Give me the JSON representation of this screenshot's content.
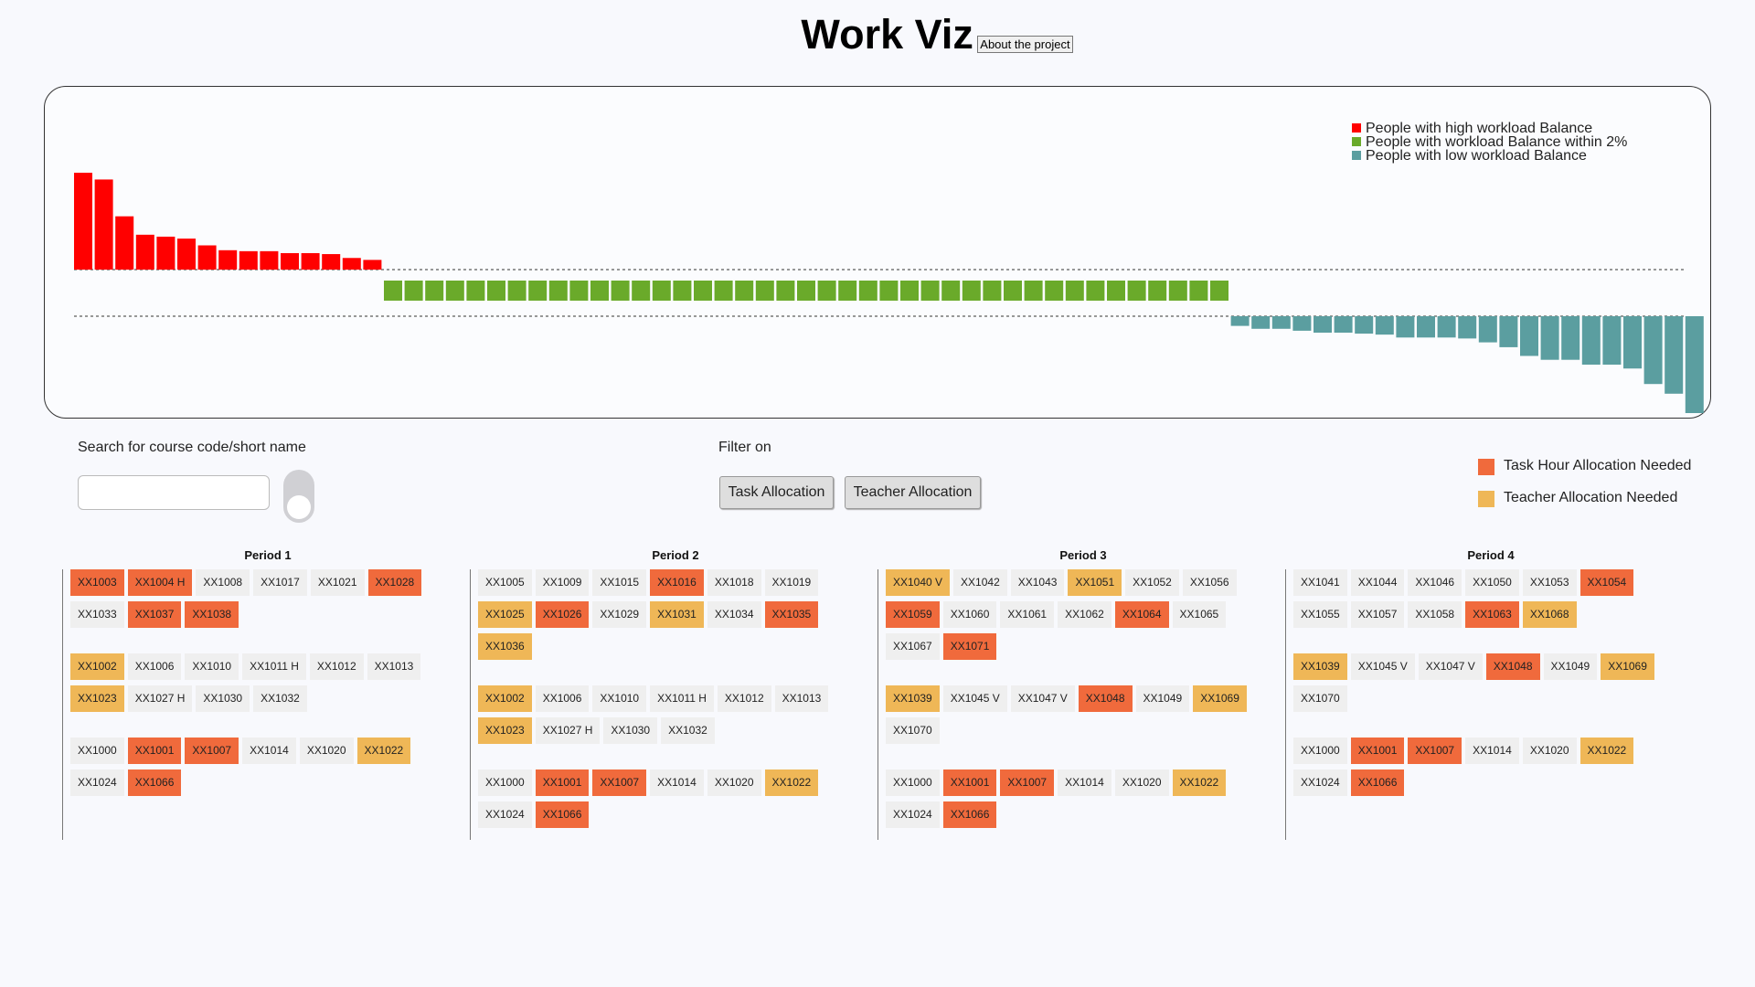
{
  "header": {
    "title": "Work Viz",
    "about_label": "About the project"
  },
  "legend": [
    {
      "label": "People with high workload Balance",
      "color": "#ff0000"
    },
    {
      "label": "People with workload Balance within 2%",
      "color": "#6aaa2a"
    },
    {
      "label": "People with low workload Balance",
      "color": "#5b9ea0"
    }
  ],
  "chart_data": {
    "type": "bar",
    "high_series": [
      100,
      93,
      55,
      36,
      34,
      32,
      25,
      20,
      19,
      19,
      17,
      17,
      16,
      12,
      10
    ],
    "balanced_count": 41,
    "low_series": [
      -10,
      -13,
      -13,
      -15,
      -17,
      -17,
      -18,
      -19,
      -22,
      -22,
      -22,
      -23,
      -27,
      -32,
      -41,
      -45,
      -45,
      -50,
      -50,
      -54,
      -70,
      -80,
      -100
    ]
  },
  "controls": {
    "search_label": "Search for course code/short name",
    "search_value": "",
    "filter_label": "Filter on",
    "task_btn": "Task Allocation",
    "teacher_btn": "Teacher Allocation",
    "legend_task": "Task Hour Allocation Needed",
    "legend_teacher": "Teacher Allocation Needed",
    "color_task": "#f06a3c",
    "color_teacher": "#efb757"
  },
  "periods": [
    {
      "title": "Period 1",
      "groups": [
        [
          [
            "XX1003",
            "task"
          ],
          [
            "XX1004 H",
            "task"
          ],
          [
            "XX1008",
            ""
          ],
          [
            "XX1017",
            ""
          ],
          [
            "XX1021",
            ""
          ],
          [
            "XX1028",
            "task"
          ],
          [
            "XX1033",
            ""
          ],
          [
            "XX1037",
            "task"
          ],
          [
            "XX1038",
            "task"
          ]
        ],
        [
          [
            "XX1002",
            "teacher"
          ],
          [
            "XX1006",
            ""
          ],
          [
            "XX1010",
            ""
          ],
          [
            "XX1011 H",
            ""
          ],
          [
            "XX1012",
            ""
          ],
          [
            "XX1013",
            ""
          ],
          [
            "XX1023",
            "teacher"
          ],
          [
            "XX1027 H",
            ""
          ],
          [
            "XX1030",
            ""
          ],
          [
            "XX1032",
            ""
          ]
        ],
        [
          [
            "XX1000",
            ""
          ],
          [
            "XX1001",
            "task"
          ],
          [
            "XX1007",
            "task"
          ],
          [
            "XX1014",
            ""
          ],
          [
            "XX1020",
            ""
          ],
          [
            "XX1022",
            "teacher"
          ],
          [
            "XX1024",
            ""
          ],
          [
            "XX1066",
            "task"
          ]
        ]
      ]
    },
    {
      "title": "Period 2",
      "groups": [
        [
          [
            "XX1005",
            ""
          ],
          [
            "XX1009",
            ""
          ],
          [
            "XX1015",
            ""
          ],
          [
            "XX1016",
            "task"
          ],
          [
            "XX1018",
            ""
          ],
          [
            "XX1019",
            ""
          ],
          [
            "XX1025",
            "teacher"
          ],
          [
            "XX1026",
            "task"
          ],
          [
            "XX1029",
            ""
          ],
          [
            "XX1031",
            "teacher"
          ],
          [
            "XX1034",
            ""
          ],
          [
            "XX1035",
            "task"
          ],
          [
            "XX1036",
            "teacher"
          ]
        ],
        [
          [
            "XX1002",
            "teacher"
          ],
          [
            "XX1006",
            ""
          ],
          [
            "XX1010",
            ""
          ],
          [
            "XX1011 H",
            ""
          ],
          [
            "XX1012",
            ""
          ],
          [
            "XX1013",
            ""
          ],
          [
            "XX1023",
            "teacher"
          ],
          [
            "XX1027 H",
            ""
          ],
          [
            "XX1030",
            ""
          ],
          [
            "XX1032",
            ""
          ]
        ],
        [
          [
            "XX1000",
            ""
          ],
          [
            "XX1001",
            "task"
          ],
          [
            "XX1007",
            "task"
          ],
          [
            "XX1014",
            ""
          ],
          [
            "XX1020",
            ""
          ],
          [
            "XX1022",
            "teacher"
          ],
          [
            "XX1024",
            ""
          ],
          [
            "XX1066",
            "task"
          ]
        ]
      ]
    },
    {
      "title": "Period 3",
      "groups": [
        [
          [
            "XX1040 V",
            "teacher"
          ],
          [
            "XX1042",
            ""
          ],
          [
            "XX1043",
            ""
          ],
          [
            "XX1051",
            "teacher"
          ],
          [
            "XX1052",
            ""
          ],
          [
            "XX1056",
            ""
          ],
          [
            "XX1059",
            "task"
          ],
          [
            "XX1060",
            ""
          ],
          [
            "XX1061",
            ""
          ],
          [
            "XX1062",
            ""
          ],
          [
            "XX1064",
            "task"
          ],
          [
            "XX1065",
            ""
          ],
          [
            "XX1067",
            ""
          ],
          [
            "XX1071",
            "task"
          ]
        ],
        [
          [
            "XX1039",
            "teacher"
          ],
          [
            "XX1045 V",
            ""
          ],
          [
            "XX1047 V",
            ""
          ],
          [
            "XX1048",
            "task"
          ],
          [
            "XX1049",
            ""
          ],
          [
            "XX1069",
            "teacher"
          ],
          [
            "XX1070",
            ""
          ]
        ],
        [
          [
            "XX1000",
            ""
          ],
          [
            "XX1001",
            "task"
          ],
          [
            "XX1007",
            "task"
          ],
          [
            "XX1014",
            ""
          ],
          [
            "XX1020",
            ""
          ],
          [
            "XX1022",
            "teacher"
          ],
          [
            "XX1024",
            ""
          ],
          [
            "XX1066",
            "task"
          ]
        ]
      ]
    },
    {
      "title": "Period 4",
      "groups": [
        [
          [
            "XX1041",
            ""
          ],
          [
            "XX1044",
            ""
          ],
          [
            "XX1046",
            ""
          ],
          [
            "XX1050",
            ""
          ],
          [
            "XX1053",
            ""
          ],
          [
            "XX1054",
            "task"
          ],
          [
            "XX1055",
            ""
          ],
          [
            "XX1057",
            ""
          ],
          [
            "XX1058",
            ""
          ],
          [
            "XX1063",
            "task"
          ],
          [
            "XX1068",
            "teacher"
          ]
        ],
        [
          [
            "XX1039",
            "teacher"
          ],
          [
            "XX1045 V",
            ""
          ],
          [
            "XX1047 V",
            ""
          ],
          [
            "XX1048",
            "task"
          ],
          [
            "XX1049",
            ""
          ],
          [
            "XX1069",
            "teacher"
          ],
          [
            "XX1070",
            ""
          ]
        ],
        [
          [
            "XX1000",
            ""
          ],
          [
            "XX1001",
            "task"
          ],
          [
            "XX1007",
            "task"
          ],
          [
            "XX1014",
            ""
          ],
          [
            "XX1020",
            ""
          ],
          [
            "XX1022",
            "teacher"
          ],
          [
            "XX1024",
            ""
          ],
          [
            "XX1066",
            "task"
          ]
        ]
      ]
    }
  ]
}
